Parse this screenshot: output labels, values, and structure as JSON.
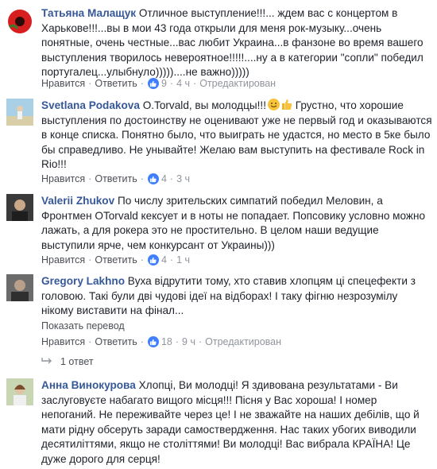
{
  "comments": [
    {
      "author": "Татьяна Малащук",
      "text": "Отличное выступление!!!... ждем вас с концертом в Харькове!!!...вы в мои 43 года открыли для меня рок-музыку...очень понятные, очень честные...вас любит Украина...в фанзоне во время вашего выступления творилось невероятное!!!!!....ну а в категории \"сопли\" победил португалец...улыбнуло)))))....не важно)))))",
      "like": "Нравится",
      "reply": "Ответить",
      "count": "9",
      "time": "4 ч",
      "edited": "Отредактирован"
    },
    {
      "author": "Svetlana Podakova",
      "text_before": "O.Torvald, вы молодцы!!!",
      "text": "Грустно, что хорошие выступления по достоинству не оценивают уже не первый год и оказываются в конце списка. Понятно было, что выиграть не удастся, но место в 5ке было бы справедливо. Не унывайте! Желаю вам выступить на фестивале Rock in Rio!!!",
      "like": "Нравится",
      "reply": "Ответить",
      "count": "4",
      "time": "3 ч"
    },
    {
      "author": "Valerii Zhukov",
      "text": "По числу зрительских симпатий победил Меловин, а Фронтмен OTorvald кексует и в ноты не попадает. Попсовику условно можно лажать, а для рокера это не простительно. В целом наши ведущие выступили ярче, чем конкурсант от Украины)))",
      "like": "Нравится",
      "reply": "Ответить",
      "count": "4",
      "time": "1 ч"
    },
    {
      "author": "Gregory Lakhno",
      "text": "Вуха відрутити тому, хто ставив хлопцям ці спецефекти з головою. Такі були дві чудові ідеї на відборах! І таку фігню незрозумілу нікому виставити на фінал...",
      "translate": "Показать перевод",
      "like": "Нравится",
      "reply": "Ответить",
      "count": "18",
      "time": "9 ч",
      "edited": "Отредактирован",
      "replies": "1 ответ"
    },
    {
      "author": "Анна Винокурова",
      "text": "Хлопці, Ви молодці! Я здивована результатами - Ви заслуговуєте набагато вищого місця!!! Пісня у Вас хороша! І номер непоганий. Не переживайте через це! І не зважайте на наших дебілів, що й мати рідну обсеруть заради самоствердження. Нас таких убогих виводили десятиліттями, якщо не століттями! Ви молодці! Вас вибрала КРАЇНА! Це дуже дорого для серця!"
    }
  ],
  "icons": {
    "reaction": "thumbs-up-icon",
    "reply_arrow": "reply-arrow-icon"
  },
  "colors": {
    "author": "#365899",
    "meta": "#90949c",
    "reaction": "#4080ff"
  }
}
